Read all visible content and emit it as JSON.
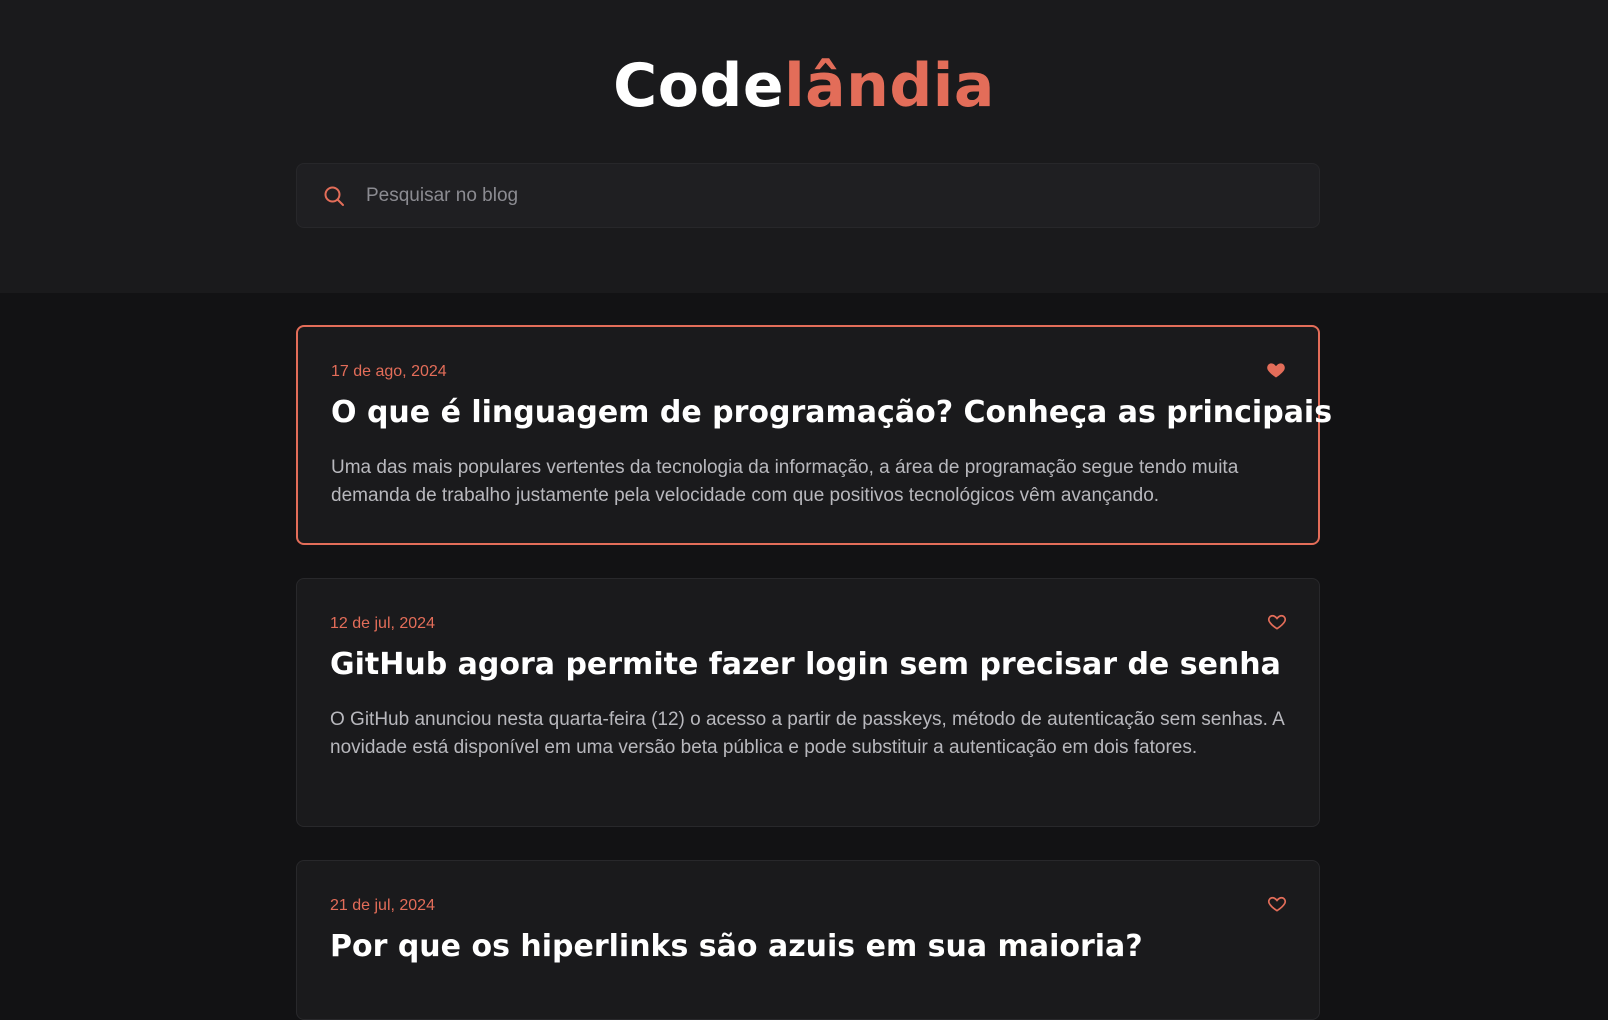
{
  "brand": {
    "part1": "Code",
    "part2": "lândia"
  },
  "search": {
    "placeholder": "Pesquisar no blog",
    "value": ""
  },
  "colors": {
    "accent": "#e36d59",
    "header_bg": "#1a1a1c",
    "page_bg": "#121214",
    "card_bg": "#1a1a1c"
  },
  "posts": [
    {
      "date": "17 de ago, 2024",
      "title": "O que é linguagem de programação? Conheça as principais",
      "description": "Uma das mais populares vertentes da tecnologia da informação, a área de programação segue tendo muita demanda de trabalho justamente pela velocidade com que positivos tecnológicos vêm avançando.",
      "liked": true,
      "active": true
    },
    {
      "date": "12 de jul, 2024",
      "title": "GitHub agora permite fazer login sem precisar de senha",
      "description": "O GitHub anunciou nesta quarta-feira (12) o acesso a partir de passkeys, método de autenticação sem senhas. A novidade está disponível em uma versão beta pública e pode substituir a autenticação em dois fatores.",
      "liked": false,
      "active": false
    },
    {
      "date": "21 de jul, 2024",
      "title": "Por que os hiperlinks são azuis em sua maioria?",
      "liked": false,
      "active": false
    }
  ]
}
